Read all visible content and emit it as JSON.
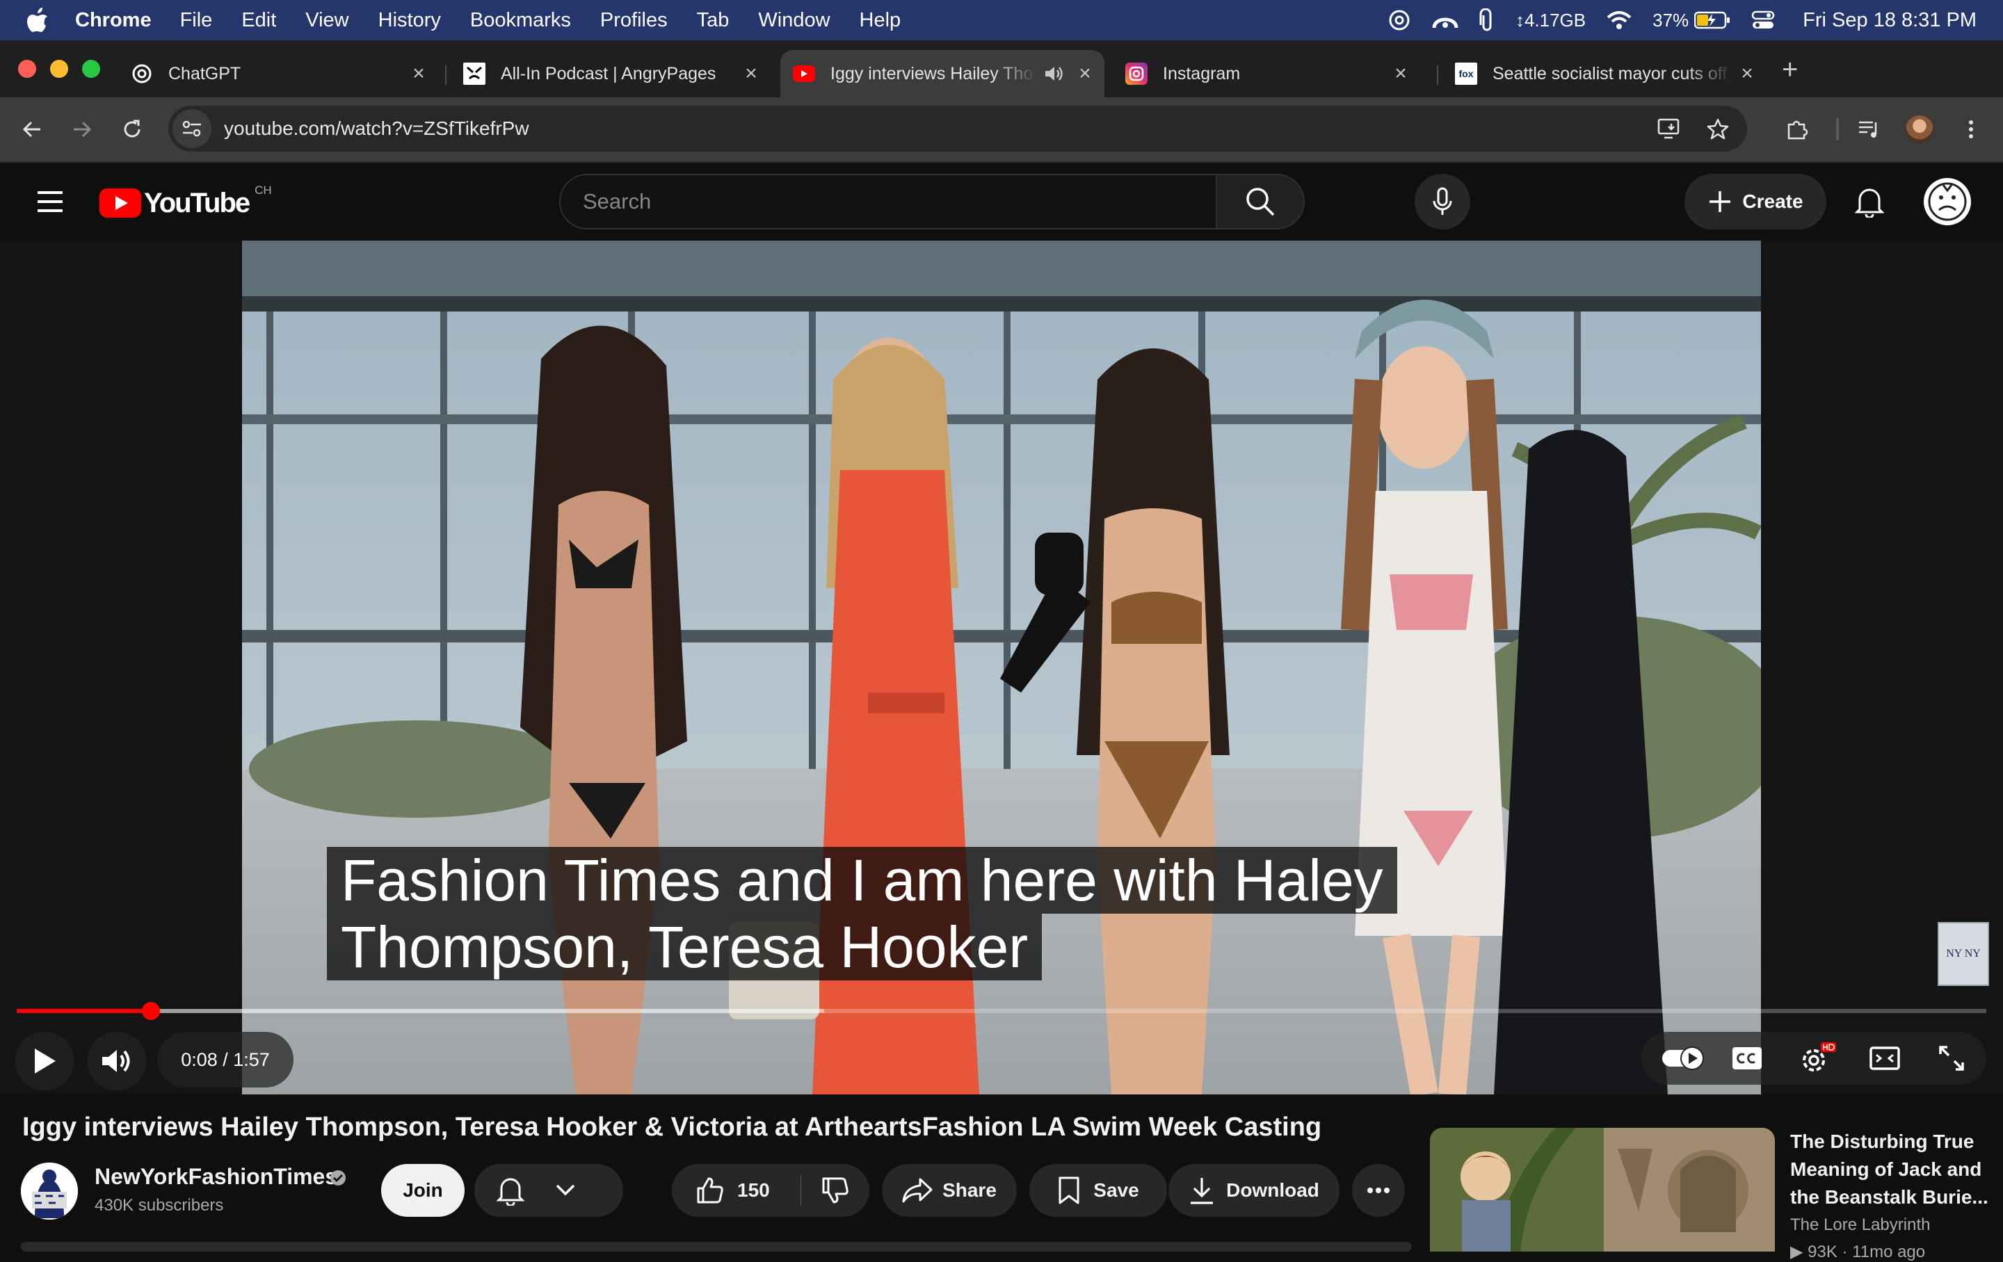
{
  "menubar": {
    "app_name": "Chrome",
    "items": [
      "File",
      "Edit",
      "View",
      "History",
      "Bookmarks",
      "Profiles",
      "Tab",
      "Window",
      "Help"
    ],
    "memory": "↕4.17GB",
    "battery": "37%",
    "clock": "Fri Sep 18  8:31 PM"
  },
  "tabs": [
    {
      "title": "ChatGPT",
      "favicon": "chatgpt-icon"
    },
    {
      "title": "All-In Podcast | AngryPages",
      "favicon": "angrypages-icon"
    },
    {
      "title": "Iggy interviews Hailey Thompson",
      "favicon": "youtube-icon",
      "active": true,
      "audio": true
    },
    {
      "title": "Instagram",
      "favicon": "instagram-icon"
    },
    {
      "title": "Seattle socialist mayor cuts off",
      "favicon": "fox-news-icon"
    }
  ],
  "tab_close_glyph": "×",
  "new_tab_glyph": "+",
  "fox_favicon_text": "fox",
  "toolbar": {
    "url": "youtube.com/watch?v=ZSfTikefrPw"
  },
  "masthead": {
    "logo_text": "YouTube",
    "region": "CH",
    "search_placeholder": "Search",
    "create_label": "Create"
  },
  "player": {
    "captions": [
      "Fashion Times and I am here with Haley",
      "Thompson, Teresa Hooker"
    ],
    "time": "0:08 / 1:57",
    "progress_fraction": 0.068,
    "buffered_fraction": 0.41,
    "watermark": "NY NY"
  },
  "video": {
    "title": "Iggy interviews Hailey Thompson, Teresa Hooker & Victoria at ArtheartsFashion LA Swim Week Casting",
    "channel": "NewYorkFashionTimes",
    "subscribers": "430K subscribers",
    "join_label": "Join",
    "likes": "150",
    "share_label": "Share",
    "save_label": "Save",
    "download_label": "Download"
  },
  "related": {
    "title": "The Disturbing True Meaning of Jack and the Beanstalk Burie...",
    "channel": "The Lore Labyrinth",
    "meta": "▶ 93K · 11mo ago"
  },
  "colors": {
    "yt_red": "#ff0000",
    "menubar": "#24366b",
    "dress_orange": "#e8563a"
  }
}
